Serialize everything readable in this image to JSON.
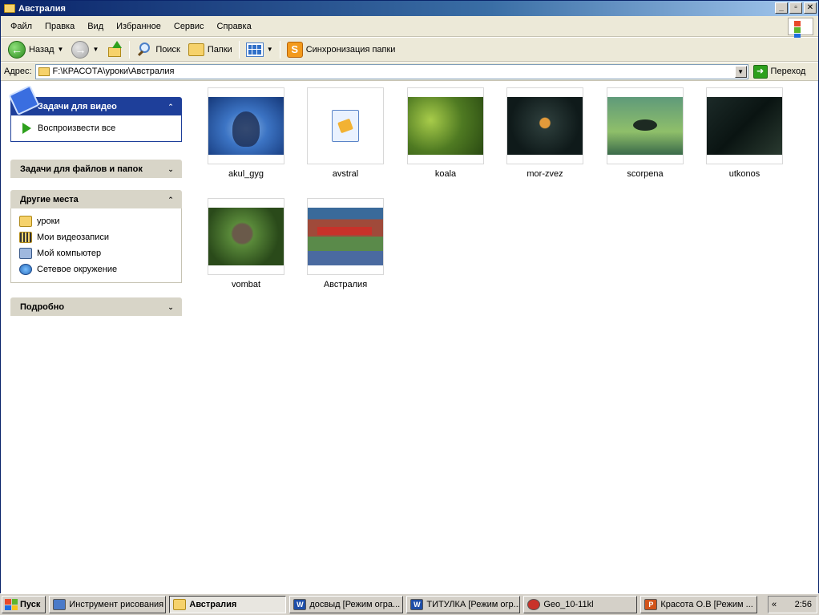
{
  "window": {
    "title": "Австралия",
    "controls": {
      "minimize": "_",
      "restore": "▫",
      "close": "✕"
    }
  },
  "menu": [
    "Файл",
    "Правка",
    "Вид",
    "Избранное",
    "Сервис",
    "Справка"
  ],
  "toolbar": {
    "back": "Назад",
    "search": "Поиск",
    "folders": "Папки",
    "sync": "Синхронизация папки"
  },
  "address": {
    "label": "Адрес:",
    "value": "F:\\КРАСОТА\\уроки\\Австралия",
    "go": "Переход"
  },
  "taskpane": {
    "video_tasks": {
      "title": "Задачи для видео",
      "items": [
        "Воспроизвести все"
      ]
    },
    "file_tasks": {
      "title": "Задачи для файлов и папок"
    },
    "other_places": {
      "title": "Другие места",
      "items": [
        {
          "label": "уроки",
          "icon": "folder-icon"
        },
        {
          "label": "Мои видеозаписи",
          "icon": "my-videos-icon"
        },
        {
          "label": "Мой компьютер",
          "icon": "my-computer-icon"
        },
        {
          "label": "Сетевое окружение",
          "icon": "network-icon"
        }
      ]
    },
    "details": {
      "title": "Подробно"
    }
  },
  "files": [
    {
      "name": "akul_gyg",
      "thumb": "akul"
    },
    {
      "name": "avstral",
      "thumb": "doc"
    },
    {
      "name": "koala",
      "thumb": "koala"
    },
    {
      "name": "mor-zvez",
      "thumb": "morzvez"
    },
    {
      "name": "scorpena",
      "thumb": "scorpena"
    },
    {
      "name": "utkonos",
      "thumb": "utkonos"
    },
    {
      "name": "vombat",
      "thumb": "vombat"
    },
    {
      "name": "Австралия",
      "thumb": "avstralia"
    }
  ],
  "taskbar": {
    "start": "Пуск",
    "tasks": [
      {
        "label": "Инструмент рисования",
        "icon": "paint-icon",
        "active": false
      },
      {
        "label": "Австралия",
        "icon": "folder-icon",
        "active": true
      },
      {
        "label": "досвыд [Режим огра...",
        "icon": "word-icon",
        "active": false
      },
      {
        "label": "ТИТУЛКА [Режим огр...",
        "icon": "word-icon",
        "active": false
      },
      {
        "label": "Geo_10-11kl",
        "icon": "browser-icon",
        "active": false
      },
      {
        "label": "Красота  О.В [Режим ...",
        "icon": "powerpoint-icon",
        "active": false
      }
    ],
    "tray_chevron": "«",
    "clock": "2:56"
  },
  "colors": {
    "titlebar": "#0a246a",
    "panel_blue": "#1e3f9a",
    "chrome": "#ece9d8",
    "taskbar": "#d4d0c8"
  }
}
